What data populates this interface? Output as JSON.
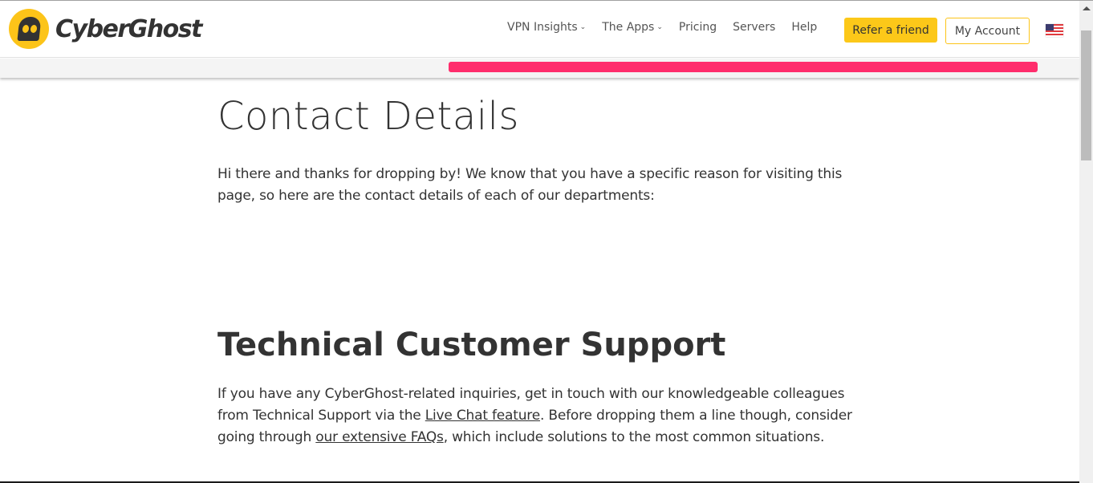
{
  "header": {
    "logo_text": "CyberGhost",
    "nav": [
      {
        "label": "VPN Insights",
        "has_dropdown": true
      },
      {
        "label": "The Apps",
        "has_dropdown": true
      },
      {
        "label": "Pricing",
        "has_dropdown": false
      },
      {
        "label": "Servers",
        "has_dropdown": false
      },
      {
        "label": "Help",
        "has_dropdown": false
      }
    ],
    "chevron_glyph": "⌄",
    "refer_label": "Refer a friend",
    "account_label": "My Account",
    "language_icon": "us-flag-icon"
  },
  "colors": {
    "brand_yellow": "#fcc419",
    "banner_pink": "#ff2d6c",
    "text": "#333333"
  },
  "main": {
    "title": "Contact Details",
    "intro": "Hi there and thanks for dropping by! We know that you have a specific reason for visiting this page, so here are the contact details of each of our departments:",
    "sections": [
      {
        "title": "Technical Customer Support",
        "text_1": "If you have any CyberGhost-related inquiries, get in touch with our knowledgeable colleagues from Technical Support via the ",
        "link_1": "Live Chat feature",
        "text_2": ". Before dropping them a line though, consider going through ",
        "link_2": "our extensive FAQs",
        "text_3": ", which include solutions to the most common situations."
      }
    ]
  }
}
